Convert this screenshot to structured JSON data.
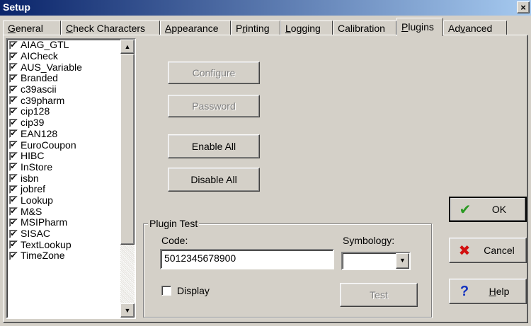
{
  "window": {
    "title": "Setup",
    "close_glyph": "×"
  },
  "tabs": [
    {
      "pre": "",
      "ul": "G",
      "post": "eneral"
    },
    {
      "pre": "",
      "ul": "C",
      "post": "heck Characters"
    },
    {
      "pre": "",
      "ul": "A",
      "post": "ppearance"
    },
    {
      "pre": "P",
      "ul": "r",
      "post": "inting"
    },
    {
      "pre": "",
      "ul": "L",
      "post": "ogging"
    },
    {
      "pre": "Calibration",
      "ul": "",
      "post": ""
    },
    {
      "pre": "",
      "ul": "P",
      "post": "lugins"
    },
    {
      "pre": "Ad",
      "ul": "v",
      "post": "anced"
    }
  ],
  "active_tab": 6,
  "plugins": [
    "AIAG_GTL",
    "AICheck",
    "AUS_Variable",
    "Branded",
    "c39ascii",
    "c39pharm",
    "cip128",
    "cip39",
    "EAN128",
    "EuroCoupon",
    "HIBC",
    "InStore",
    "isbn",
    "jobref",
    "Lookup",
    "M&S",
    "MSIPharm",
    "SISAC",
    "TextLookup",
    "TimeZone"
  ],
  "check_glyph": "✔",
  "buttons": {
    "configure": "Configure",
    "password": "Password",
    "enable_all": "Enable All",
    "disable_all": "Disable All"
  },
  "plugin_test": {
    "legend": "Plugin Test",
    "code_label": "Code:",
    "code_value": "5012345678900",
    "symbology_label": "Symbology:",
    "symbology_value": "",
    "display_label": "Display",
    "display_checked": false,
    "test_label": "Test"
  },
  "dialog": {
    "ok": "OK",
    "cancel": "Cancel",
    "help_ul": "H",
    "help_post": "elp"
  },
  "colors": {
    "ok_icon": "#2a9a22",
    "cancel_icon": "#d21010",
    "help_icon": "#1030c0"
  }
}
